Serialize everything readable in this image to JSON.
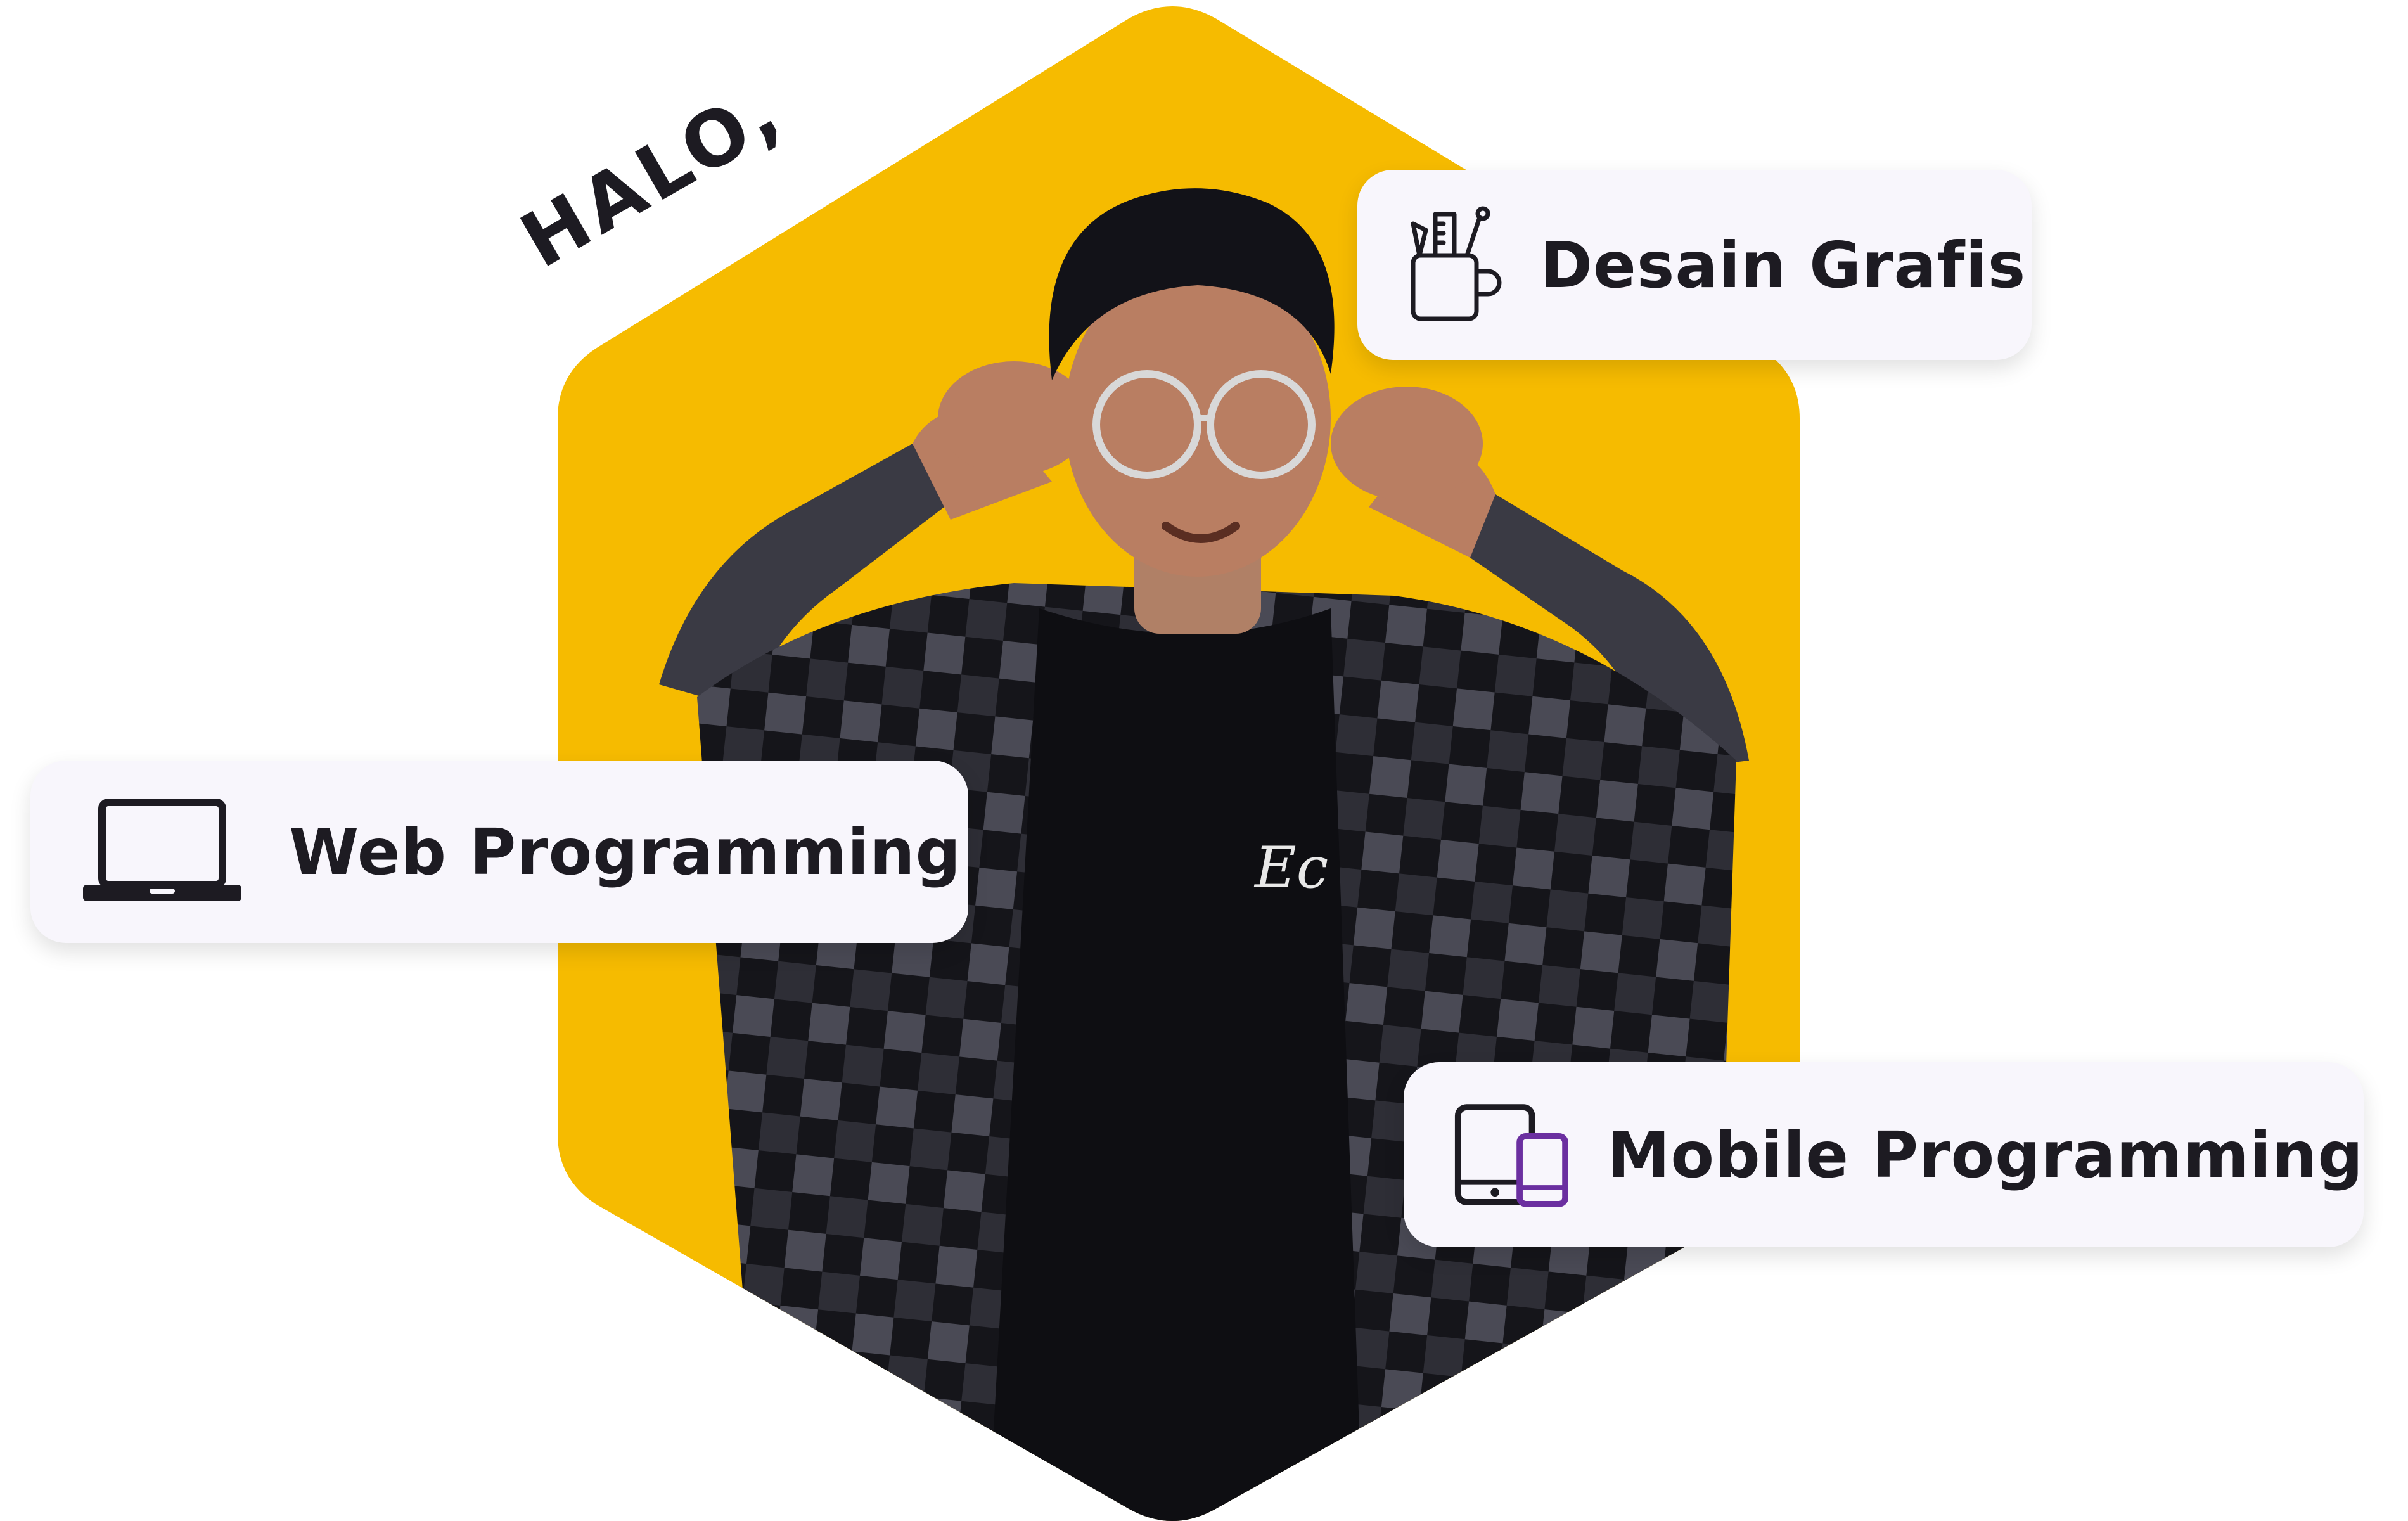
{
  "greeting": "HALO,",
  "colors": {
    "hexagon": "#F6BB00",
    "card_background": "#F8F6FC",
    "text": "#1D1B22",
    "accent_purple": "#6B2FA0",
    "shirt_dark": "#15151A",
    "shirt_check": "#4A4A55",
    "skin": "#B97E62",
    "hair": "#121218"
  },
  "skills": [
    {
      "label": "Desain Grafis",
      "icon": "pencil-cup-icon"
    },
    {
      "label": "Web Programming",
      "icon": "laptop-icon"
    },
    {
      "label": "Mobile Programming",
      "icon": "tablet-phone-icon"
    }
  ]
}
